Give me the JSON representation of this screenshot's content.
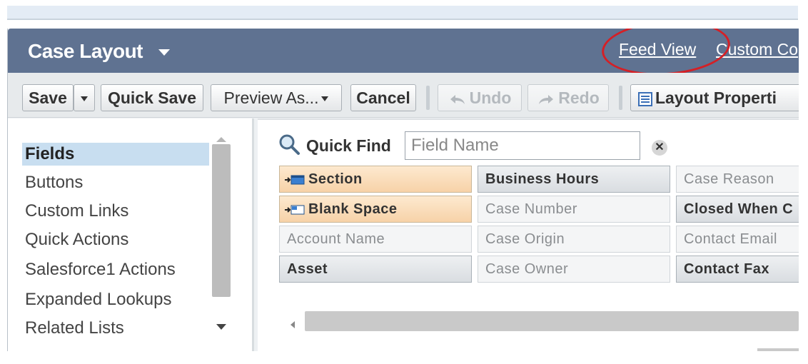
{
  "header": {
    "title": "Case Layout",
    "links": {
      "feed_view": "Feed View",
      "custom": "Custom Co"
    }
  },
  "toolbar": {
    "save": "Save",
    "quick_save": "Quick Save",
    "preview_as": "Preview As...",
    "cancel": "Cancel",
    "undo": "Undo",
    "redo": "Redo",
    "layout_properties": "Layout Properti"
  },
  "palette": {
    "categories": [
      "Fields",
      "Buttons",
      "Custom Links",
      "Quick Actions",
      "Salesforce1 Actions",
      "Expanded Lookups",
      "Related Lists"
    ],
    "selected": "Fields"
  },
  "quick_find": {
    "label": "Quick Find",
    "placeholder": "Field Name"
  },
  "fields": [
    [
      "Section",
      "Business Hours",
      "Case Reason"
    ],
    [
      "Blank Space",
      "Case Number",
      "Closed When C"
    ],
    [
      "Account Name",
      "Case Origin",
      "Contact Email"
    ],
    [
      "Asset",
      "Case Owner",
      "Contact Fax"
    ]
  ],
  "colors": {
    "header_bg": "#5f7291",
    "annotation": "#d42026",
    "selected_bg": "#c8def0",
    "special_field": "#f7d2a8"
  }
}
